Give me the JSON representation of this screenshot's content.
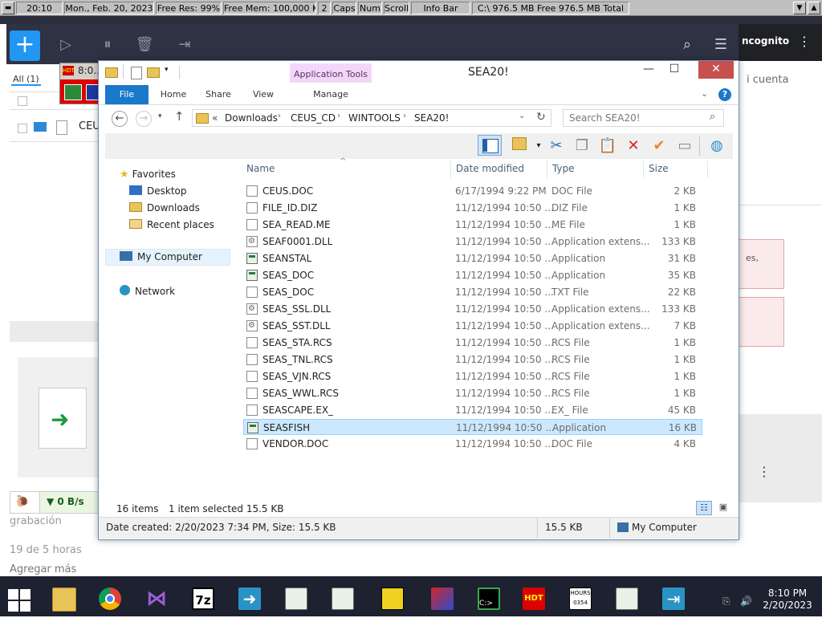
{
  "infobar": {
    "time": "20:10",
    "date": "Mon., Feb. 20, 2023",
    "free_res": "Free Res: 99%",
    "free_mem": "Free Mem: 100,000 KB",
    "num": "2",
    "caps": "Caps",
    "numlock": "Num",
    "scroll": "Scroll",
    "info_bar": "Info Bar",
    "disk": "C:\\ 976.5 MB Free  976.5 MB Total"
  },
  "background": {
    "incognito": "ncognito",
    "cuenta": "i cuenta",
    "all_tab": "All (1)",
    "list_item": "CEU",
    "speed": "▼ 0 B/s",
    "gr": "grabación",
    "time_ago": "19 de 5 horas",
    "add_more": "Agregar más",
    "hdt_time": "8:0..",
    "redbox_text": "es,"
  },
  "window": {
    "title": "SEA20!",
    "app_tools": "Application Tools",
    "tabs": [
      "File",
      "Home",
      "Share",
      "View",
      "Manage"
    ]
  },
  "address": {
    "prefix": "«",
    "crumbs": [
      "Downloads",
      "CEUS_CD",
      "WINTOOLS",
      "SEA20!"
    ],
    "search_placeholder": "Search SEA20!"
  },
  "nav": {
    "favorites": "Favorites",
    "desktop": "Desktop",
    "downloads": "Downloads",
    "recent": "Recent places",
    "computer": "My Computer",
    "network": "Network"
  },
  "columns": {
    "name": "Name",
    "date": "Date modified",
    "type": "Type",
    "size": "Size"
  },
  "files": [
    {
      "name": "CEUS.DOC",
      "date": "6/17/1994 9:22 PM",
      "type": "DOC File",
      "size": "2 KB",
      "icon": "doc"
    },
    {
      "name": "FILE_ID.DIZ",
      "date": "11/12/1994 10:50 ...",
      "type": "DIZ File",
      "size": "1 KB",
      "icon": "doc"
    },
    {
      "name": "SEA_READ.ME",
      "date": "11/12/1994 10:50 ...",
      "type": "ME File",
      "size": "1 KB",
      "icon": "doc"
    },
    {
      "name": "SEAF0001.DLL",
      "date": "11/12/1994 10:50 ...",
      "type": "Application extens...",
      "size": "133 KB",
      "icon": "dll"
    },
    {
      "name": "SEANSTAL",
      "date": "11/12/1994 10:50 ...",
      "type": "Application",
      "size": "31 KB",
      "icon": "app"
    },
    {
      "name": "SEAS_DOC",
      "date": "11/12/1994 10:50 ...",
      "type": "Application",
      "size": "35 KB",
      "icon": "app"
    },
    {
      "name": "SEAS_DOC",
      "date": "11/12/1994 10:50 ...",
      "type": "TXT File",
      "size": "22 KB",
      "icon": "doc"
    },
    {
      "name": "SEAS_SSL.DLL",
      "date": "11/12/1994 10:50 ...",
      "type": "Application extens...",
      "size": "133 KB",
      "icon": "dll"
    },
    {
      "name": "SEAS_SST.DLL",
      "date": "11/12/1994 10:50 ...",
      "type": "Application extens...",
      "size": "7 KB",
      "icon": "dll"
    },
    {
      "name": "SEAS_STA.RCS",
      "date": "11/12/1994 10:50 ...",
      "type": "RCS File",
      "size": "1 KB",
      "icon": "doc"
    },
    {
      "name": "SEAS_TNL.RCS",
      "date": "11/12/1994 10:50 ...",
      "type": "RCS File",
      "size": "1 KB",
      "icon": "doc"
    },
    {
      "name": "SEAS_VJN.RCS",
      "date": "11/12/1994 10:50 ...",
      "type": "RCS File",
      "size": "1 KB",
      "icon": "doc"
    },
    {
      "name": "SEAS_WWL.RCS",
      "date": "11/12/1994 10:50 ...",
      "type": "RCS File",
      "size": "1 KB",
      "icon": "doc"
    },
    {
      "name": "SEASCAPE.EX_",
      "date": "11/12/1994 10:50 ...",
      "type": "EX_ File",
      "size": "45 KB",
      "icon": "doc"
    },
    {
      "name": "SEASFISH",
      "date": "11/12/1994 10:50 ...",
      "type": "Application",
      "size": "16 KB",
      "icon": "app",
      "selected": true
    },
    {
      "name": "VENDOR.DOC",
      "date": "11/12/1994 10:50 ...",
      "type": "DOC File",
      "size": "4 KB",
      "icon": "doc"
    }
  ],
  "status": {
    "items": "16 items",
    "selected": "1 item selected  15.5 KB"
  },
  "details": {
    "created": "Date created: 2/20/2023 7:34 PM, Size: 15.5 KB",
    "size": "15.5 KB",
    "location": "My Computer"
  },
  "taskbar": {
    "time": "8:10 PM",
    "date": "2/20/2023"
  },
  "colors": {
    "accent": "#1979ca",
    "selection": "#cce8ff",
    "close": "#c7504e",
    "app_tools": "#f4d7f8",
    "taskbar": "#1d2130"
  }
}
